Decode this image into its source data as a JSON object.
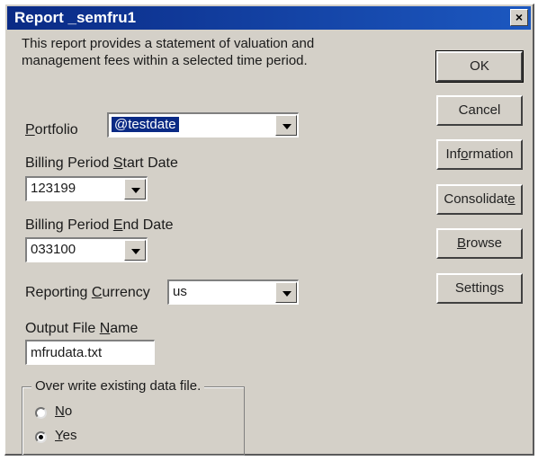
{
  "window": {
    "title": "Report _semfru1",
    "close_glyph": "×"
  },
  "description": "This report provides a statement of valuation and management fees within a selected time period.",
  "portfolio": {
    "label_pre": "",
    "label_key": "P",
    "label_post": "ortfolio",
    "value": "@testdate"
  },
  "start_date": {
    "label_pre": "Billing Period ",
    "label_key": "S",
    "label_post": "tart Date",
    "value": "123199"
  },
  "end_date": {
    "label_pre": "Billing Period ",
    "label_key": "E",
    "label_post": "nd Date",
    "value": "033100"
  },
  "currency": {
    "label_pre": "Reporting ",
    "label_key": "C",
    "label_post": "urrency",
    "value": "us"
  },
  "output_file": {
    "label_pre": "Output File ",
    "label_key": "N",
    "label_post": "ame",
    "value": "mfrudata.txt"
  },
  "overwrite": {
    "label": "Over write existing data file.",
    "options": [
      {
        "key": "N",
        "rest": "o",
        "checked": false
      },
      {
        "key": "Y",
        "rest": "es",
        "checked": true
      }
    ]
  },
  "buttons": {
    "ok": "OK",
    "cancel": "Cancel",
    "information": {
      "pre": "Inf",
      "key": "o",
      "post": "rmation"
    },
    "consolidate": {
      "pre": "Consolidat",
      "key": "e",
      "post": ""
    },
    "browse": {
      "pre": "",
      "key": "B",
      "post": "rowse"
    },
    "settings": "Settings"
  }
}
